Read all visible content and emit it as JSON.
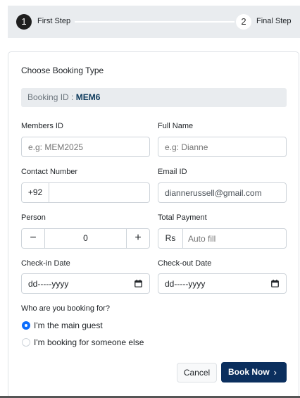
{
  "stepper": {
    "step1": {
      "number": "1",
      "label": "First Step"
    },
    "step2": {
      "number": "2",
      "label": "Final Step"
    }
  },
  "form": {
    "title": "Choose Booking Type",
    "booking_id": {
      "label": "Booking ID : ",
      "value": "MEM6"
    },
    "members_id": {
      "label": "Members ID",
      "placeholder": "e.g: MEM2025"
    },
    "full_name": {
      "label": "Full Name",
      "placeholder": "e.g: Dianne"
    },
    "contact_number": {
      "label": "Contact Number",
      "prefix": "+92",
      "value": ""
    },
    "email": {
      "label": "Email ID",
      "value": "diannerussell@gmail.com"
    },
    "person": {
      "label": "Person",
      "minus": "−",
      "value": "0",
      "plus": "+"
    },
    "total_payment": {
      "label": "Total Payment",
      "prefix": "Rs",
      "placeholder": "Auto fill"
    },
    "check_in": {
      "label": "Check-in Date",
      "value": "dd-----yyyy"
    },
    "check_out": {
      "label": "Check-out Date",
      "value": "dd-----yyyy"
    },
    "booking_for": {
      "question": "Who are you booking for?",
      "options": [
        {
          "label": "I'm the main guest",
          "selected": true
        },
        {
          "label": "I'm booking for someone else",
          "selected": false
        }
      ]
    },
    "cancel_label": "Cancel",
    "submit_label": "Book Now",
    "submit_icon": "chevron-right-icon"
  },
  "colors": {
    "accent": "#0b2f5e",
    "radio_checked": "#0d6efd",
    "stepper_bg": "#e9ecef"
  }
}
